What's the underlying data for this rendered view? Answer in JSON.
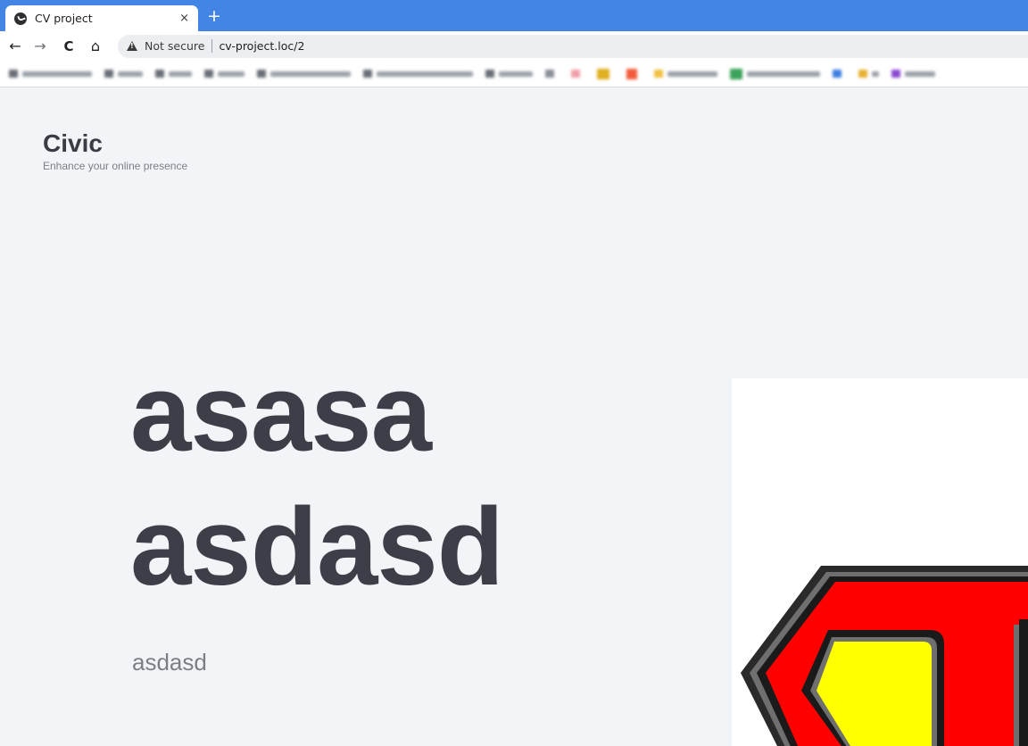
{
  "browser": {
    "tab_title": "CV project",
    "tab_close": "×",
    "new_tab": "+",
    "security_label": "Not secure",
    "url": "cv-project.loc/2",
    "nav": {
      "back": "←",
      "forward": "→",
      "reload": "C",
      "home": "⌂"
    }
  },
  "site": {
    "brand": "Civic",
    "tagline": "Enhance your online presence"
  },
  "hero": {
    "title_line1": "asasa",
    "title_line2": "asdasd",
    "subtitle": "asdasd"
  },
  "colors": {
    "tabstrip": "#4285e5",
    "page_bg": "#f2f5f8",
    "heading": "#3d3e48",
    "logo_red": "#ff0000",
    "logo_yellow": "#ffff00"
  },
  "icons": [
    "site-favicon-icon",
    "warning-icon",
    "back-arrow-icon",
    "forward-arrow-icon",
    "reload-icon",
    "home-icon",
    "superman-logo"
  ]
}
